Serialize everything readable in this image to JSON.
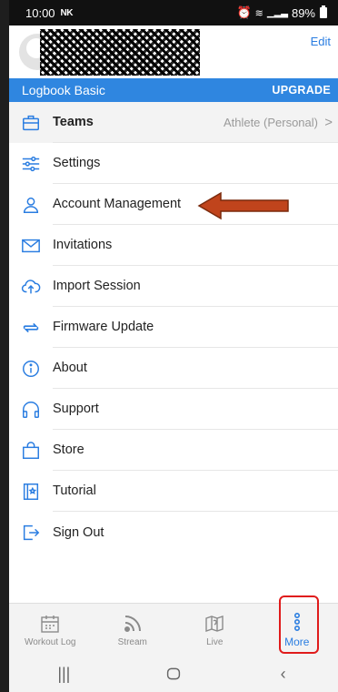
{
  "status_bar": {
    "time": "10:00",
    "carrier_icon": "NK",
    "battery": "89%"
  },
  "profile": {
    "edit_label": "Edit"
  },
  "banner": {
    "plan": "Logbook Basic",
    "upgrade": "UPGRADE"
  },
  "menu": {
    "items": [
      {
        "label": "Teams",
        "icon": "briefcase-icon",
        "value": "Athlete (Personal)",
        "chevron": ">"
      },
      {
        "label": "Settings",
        "icon": "sliders-icon"
      },
      {
        "label": "Account Management",
        "icon": "person-icon"
      },
      {
        "label": "Invitations",
        "icon": "envelope-icon"
      },
      {
        "label": "Import Session",
        "icon": "cloud-upload-icon"
      },
      {
        "label": "Firmware Update",
        "icon": "sync-icon"
      },
      {
        "label": "About",
        "icon": "info-icon"
      },
      {
        "label": "Support",
        "icon": "headphones-icon"
      },
      {
        "label": "Store",
        "icon": "shopping-bag-icon"
      },
      {
        "label": "Tutorial",
        "icon": "book-icon"
      },
      {
        "label": "Sign Out",
        "icon": "sign-out-icon"
      }
    ]
  },
  "tabs": [
    {
      "label": "Workout Log",
      "icon": "calendar-icon"
    },
    {
      "label": "Stream",
      "icon": "rss-icon"
    },
    {
      "label": "Live",
      "icon": "map-icon"
    },
    {
      "label": "More",
      "icon": "more-vertical-icon",
      "active": true
    }
  ],
  "colors": {
    "accent": "#2a7de1",
    "banner": "#2f86e0",
    "annotation_arrow": "#c0441c",
    "annotation_box": "#e01b1b"
  }
}
